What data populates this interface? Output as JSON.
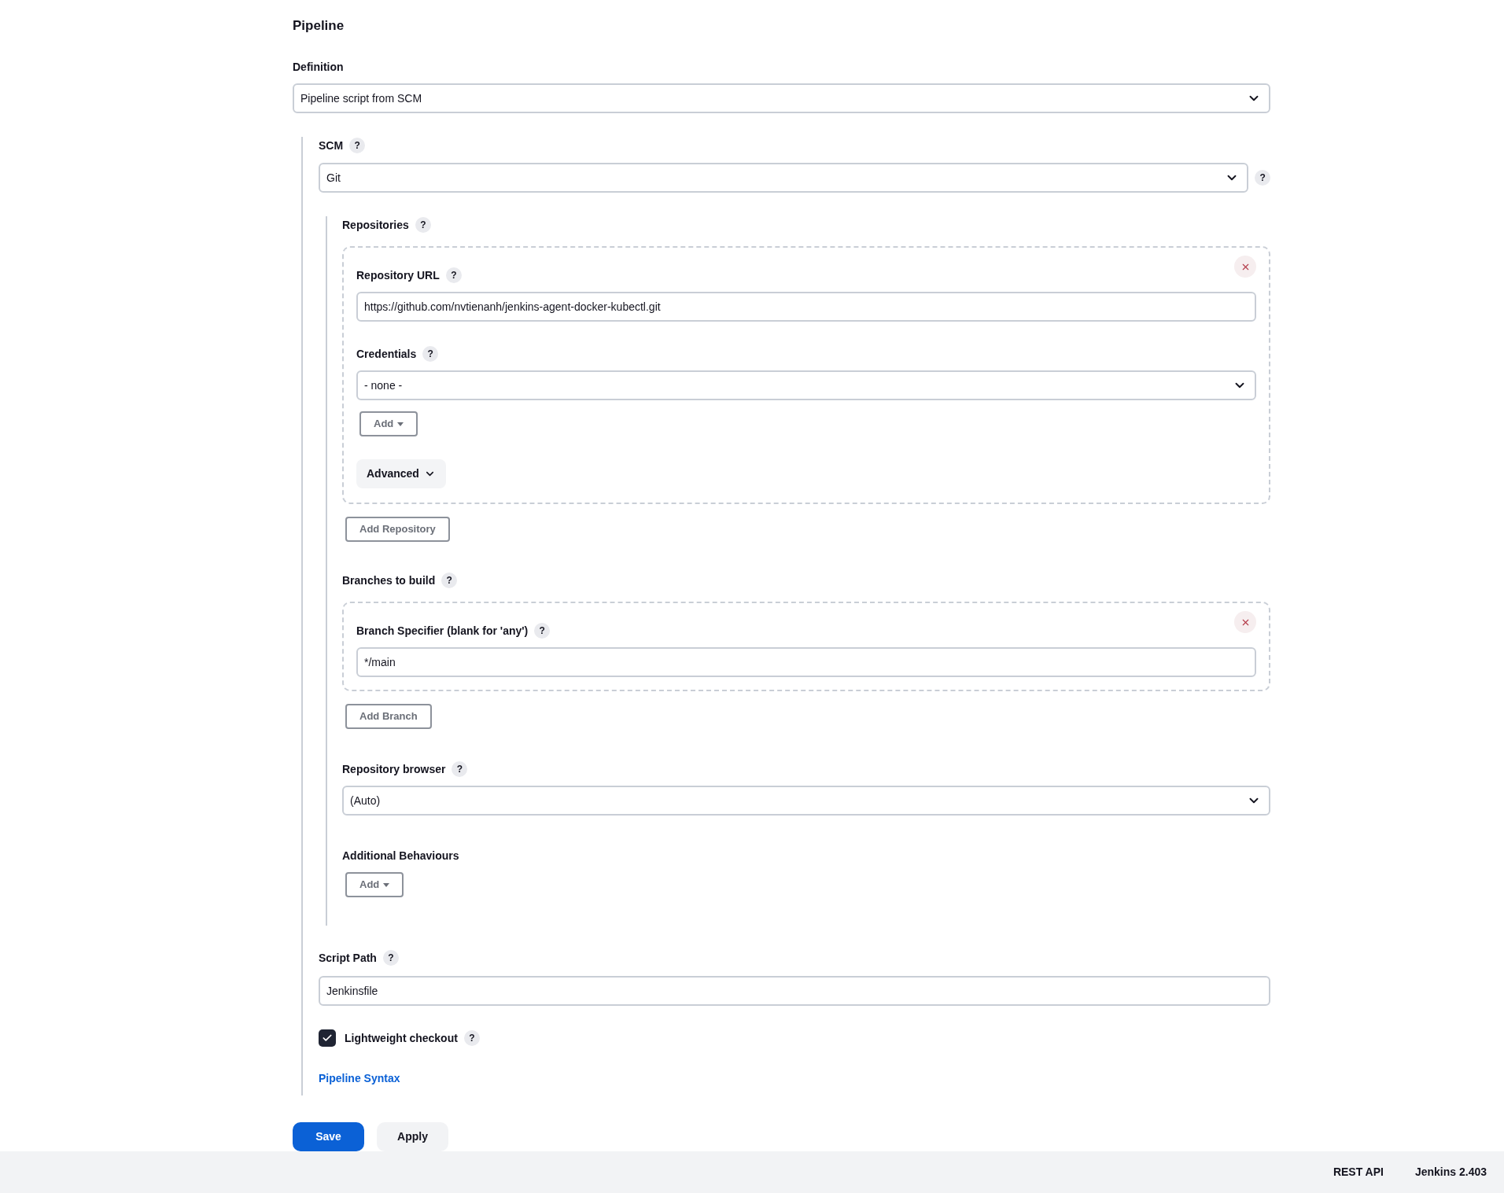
{
  "title": "Pipeline",
  "definition": {
    "label": "Definition",
    "value": "Pipeline script from SCM"
  },
  "scm": {
    "label": "SCM",
    "help": "?",
    "value": "Git",
    "side_help": "?"
  },
  "repositories": {
    "label": "Repositories",
    "help": "?",
    "items": [
      {
        "url_label": "Repository URL",
        "url_help": "?",
        "url": "https://github.com/nvtienanh/jenkins-agent-docker-kubectl.git",
        "credentials_label": "Credentials",
        "credentials_help": "?",
        "credentials": "- none -",
        "add_button": "Add",
        "advanced": "Advanced"
      }
    ],
    "add_button": "Add Repository"
  },
  "branches": {
    "label": "Branches to build",
    "help": "?",
    "items": [
      {
        "label": "Branch Specifier (blank for 'any')",
        "help": "?",
        "value": "*/main"
      }
    ],
    "add_button": "Add Branch"
  },
  "repository_browser": {
    "label": "Repository browser",
    "help": "?",
    "value": "(Auto)"
  },
  "additional_behaviours": {
    "label": "Additional Behaviours",
    "add_button": "Add"
  },
  "script_path": {
    "label": "Script Path",
    "help": "?",
    "value": "Jenkinsfile"
  },
  "lightweight_checkout": {
    "label": "Lightweight checkout",
    "help": "?",
    "checked": true
  },
  "link": "Pipeline Syntax",
  "buttons": [
    {
      "label": "Save",
      "kind": "primary"
    },
    {
      "label": "Apply",
      "kind": "secondary"
    }
  ],
  "footer": [
    "REST API",
    "Jenkins 2.403"
  ]
}
